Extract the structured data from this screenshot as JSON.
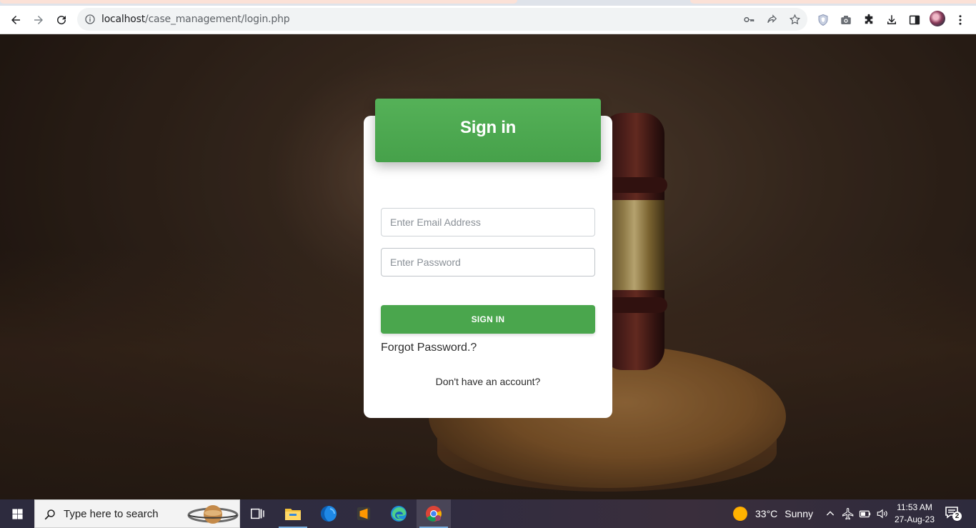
{
  "browser": {
    "url_host": "localhost",
    "url_path": "/case_management/login.php",
    "icons": [
      "back-icon",
      "forward-icon",
      "reload-icon",
      "site-info-icon",
      "key-icon",
      "share-icon",
      "bookmark-star-icon",
      "shield-extension-icon",
      "camera-extension-icon",
      "puzzle-extensions-icon",
      "download-icon",
      "side-panel-icon",
      "profile-avatar",
      "kebab-menu-icon"
    ]
  },
  "login": {
    "title": "Sign in",
    "email_placeholder": "Enter Email Address",
    "email_value": "",
    "password_placeholder": "Enter Password",
    "password_value": "",
    "submit_label": "SIGN IN",
    "forgot_label": "Forgot Password.?",
    "signup_prompt": "Don't have an account?",
    "accent_color": "#4aa64d"
  },
  "taskbar": {
    "search_placeholder": "Type here to search",
    "apps": [
      "task-view",
      "file-explorer",
      "app-blue",
      "sublime-text",
      "edge",
      "chrome"
    ],
    "weather_temp": "33°C",
    "weather_desc": "Sunny",
    "time": "11:53 AM",
    "date": "27-Aug-23",
    "notification_count": "2"
  }
}
